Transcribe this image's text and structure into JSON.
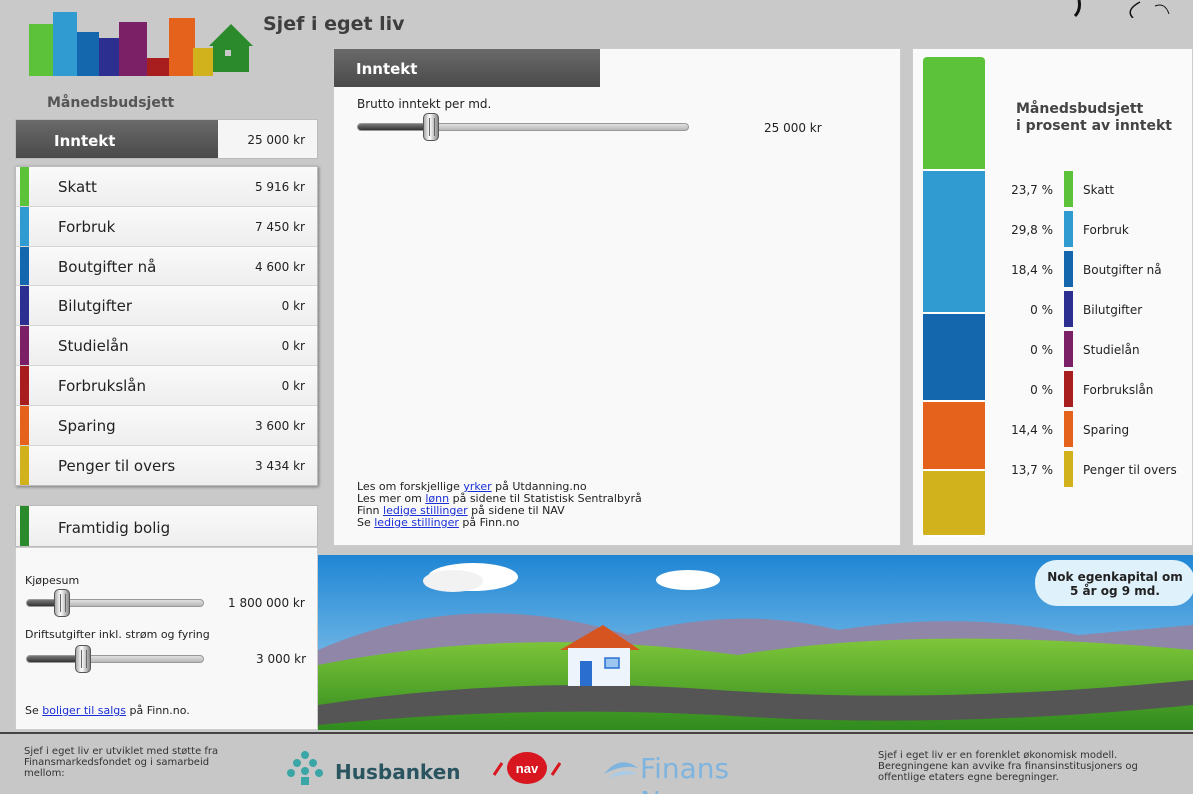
{
  "header": {
    "title": "Sjef i eget liv"
  },
  "left": {
    "heading": "Månedsbudsjett",
    "income_label": "Inntekt",
    "income_value": "25 000 kr",
    "items": [
      {
        "name": "Skatt",
        "amount": "5 916 kr",
        "color": "#5bc23a"
      },
      {
        "name": "Forbruk",
        "amount": "7 450 kr",
        "color": "#2f9bd0"
      },
      {
        "name": "Boutgifter nå",
        "amount": "4 600 kr",
        "color": "#1466ad"
      },
      {
        "name": "Bilutgifter",
        "amount": "0 kr",
        "color": "#2c2f8f"
      },
      {
        "name": "Studielån",
        "amount": "0 kr",
        "color": "#7b1f66"
      },
      {
        "name": "Forbrukslån",
        "amount": "0 kr",
        "color": "#a81e1e"
      },
      {
        "name": "Sparing",
        "amount": "3 600 kr",
        "color": "#e4621c"
      },
      {
        "name": "Penger til overs",
        "amount": "3 434 kr",
        "color": "#d2b21c"
      }
    ],
    "future_home": "Framtidig bolig",
    "home": {
      "price_label": "Kjøpesum",
      "price_value": "1 800 000 kr",
      "price_level": 0.2,
      "running_label": "Driftsutgifter inkl. strøm og fyring",
      "running_value": "3 000 kr",
      "running_level": 0.32,
      "link_prefix": "Se ",
      "link_text": "boliger til salgs",
      "link_suffix": " på Finn.no."
    }
  },
  "center": {
    "tab": "Inntekt",
    "slider_label": "Brutto inntekt per md.",
    "slider_value": "25 000 kr",
    "slider_level": 0.22,
    "links": [
      {
        "prefix": "Les om forskjellige ",
        "link": "yrker",
        "suffix": " på Utdanning.no"
      },
      {
        "prefix": "Les mer om ",
        "link": "lønn",
        "suffix": " på sidene til Statistisk Sentralbyrå"
      },
      {
        "prefix": "Finn ",
        "link": "ledige stillinger",
        "suffix": " på sidene til NAV"
      },
      {
        "prefix": "Se ",
        "link": "ledige stillinger",
        "suffix": " på Finn.no"
      }
    ]
  },
  "right": {
    "title_line1": "Månedsbudsjett",
    "title_line2": "i prosent av inntekt",
    "rows": [
      {
        "pct": "23,7 %",
        "label": "Skatt",
        "value": 23.7,
        "color": "#5bc23a"
      },
      {
        "pct": "29,8 %",
        "label": "Forbruk",
        "value": 29.8,
        "color": "#2f9bd0"
      },
      {
        "pct": "18,4 %",
        "label": "Boutgifter nå",
        "value": 18.4,
        "color": "#1466ad"
      },
      {
        "pct": "0 %",
        "label": "Bilutgifter",
        "value": 0,
        "color": "#2c2f8f"
      },
      {
        "pct": "0 %",
        "label": "Studielån",
        "value": 0,
        "color": "#7b1f66"
      },
      {
        "pct": "0 %",
        "label": "Forbrukslån",
        "value": 0,
        "color": "#a81e1e"
      },
      {
        "pct": "14,4 %",
        "label": "Sparing",
        "value": 14.4,
        "color": "#e4621c"
      },
      {
        "pct": "13,7 %",
        "label": "Penger til overs",
        "value": 13.7,
        "color": "#d2b21c"
      }
    ]
  },
  "notice": {
    "line1": "Nok egenkapital om",
    "line2": "5 år og 9 md."
  },
  "footer": {
    "left_text": "Sjef i eget liv er utviklet med støtte fra Finansmarkedsfondet og i samarbeid mellom:",
    "husbanken": "Husbanken",
    "nav": "nav",
    "finans": "Finans Norge",
    "right_text": "Sjef i eget liv er en forenklet økonomisk modell. Beregningene kan avvike fra finansinstitusjoners og offentlige etaters egne beregninger."
  }
}
